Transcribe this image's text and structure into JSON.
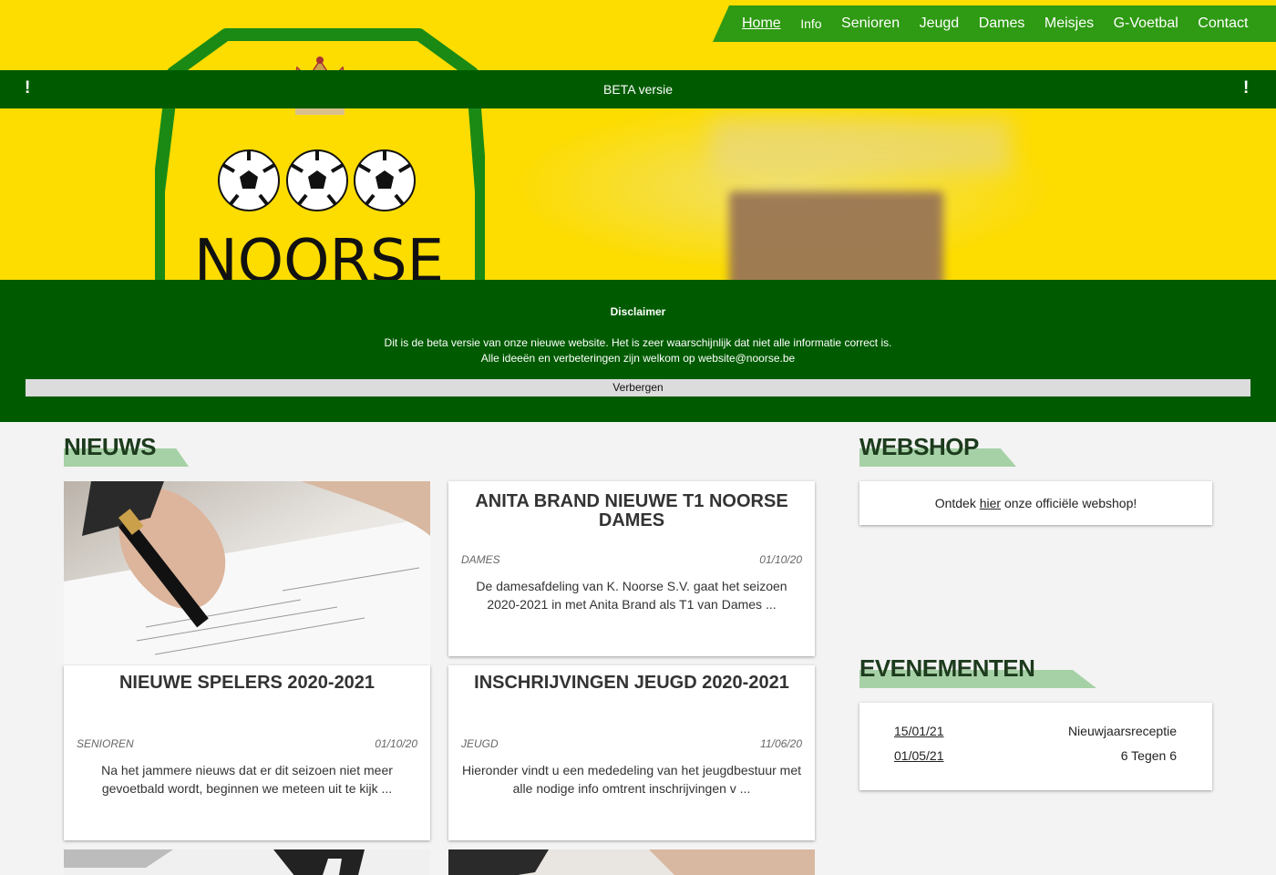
{
  "nav": {
    "items": [
      "Home",
      "Info",
      "Senioren",
      "Jeugd",
      "Dames",
      "Meisjes",
      "G-Voetbal",
      "Contact"
    ],
    "active": "Home"
  },
  "crest": {
    "text": "NOORSE"
  },
  "beta_bar": {
    "text": "BETA versie",
    "icon_left": "!",
    "icon_right": "!"
  },
  "disclaimer": {
    "title": "Disclaimer",
    "line1": "Dit is de beta versie van onze nieuwe website. Het is zeer waarschijnlijk dat niet alle informatie correct is.",
    "line2": "Alle ideeën en verbeteringen zijn welkom op website@noorse.be",
    "hide_label": "Verbergen"
  },
  "news": {
    "title": "NIEUWS",
    "articles": [
      {
        "title": "ANITA BRAND NIEUWE T1 NOORSE DAMES",
        "category": "DAMES",
        "date": "01/10/20",
        "excerpt": "De damesafdeling van K. Noorse S.V. gaat het seizoen 2020-2021 in met Anita Brand als T1 van Dames ..."
      },
      {
        "title": "NIEUWE SPELERS 2020-2021",
        "category": "SENIOREN",
        "date": "01/10/20",
        "excerpt": "Na het jammere nieuws dat er dit seizoen niet meer gevoetbald wordt, beginnen we meteen uit te kijk ..."
      },
      {
        "title": "INSCHRIJVINGEN JEUGD 2020-2021",
        "category": "JEUGD",
        "date": "11/06/20",
        "excerpt": "Hieronder vindt u een mededeling van het jeugdbestuur met alle nodige info omtrent inschrijvingen v ..."
      }
    ]
  },
  "webshop": {
    "title": "WEBSHOP",
    "prefix": "Ontdek",
    "link": "hier",
    "suffix": "onze officiële webshop!"
  },
  "events": {
    "title": "EVENEMENTEN",
    "items": [
      {
        "date": "15/01/21",
        "name": "Nieuwjaarsreceptie"
      },
      {
        "date": "01/05/21",
        "name": "6 Tegen 6"
      }
    ]
  },
  "colors": {
    "yellow": "#fddc00",
    "dark_green": "#005b00",
    "nav_green": "#2f9a13",
    "accent_bar": "#a6d1a6"
  }
}
